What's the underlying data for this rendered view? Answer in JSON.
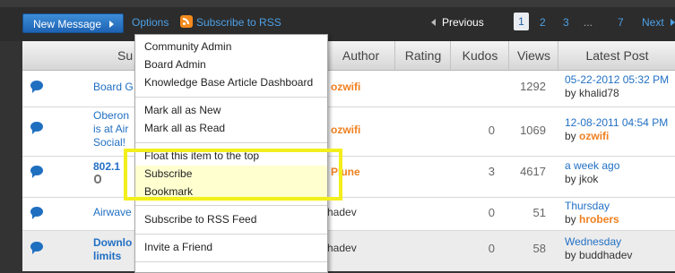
{
  "toolbar": {
    "new_message": "New Message",
    "options": "Options",
    "subscribe_rss": "Subscribe to RSS"
  },
  "pagination": {
    "previous": "Previous",
    "pages": [
      "1",
      "2",
      "3",
      "...",
      "7"
    ],
    "current": "1",
    "next": "Next"
  },
  "table": {
    "headers": [
      "Su",
      "Author",
      "Rating",
      "Kudos",
      "Views",
      "Latest Post"
    ],
    "rows": [
      {
        "subject": "Board G",
        "author": "ozwifi",
        "kudos": "",
        "views": "1292",
        "latest_date": "05-22-2012 05:32 PM",
        "latest_by_prefix": "by",
        "latest_by": "khalid78"
      },
      {
        "subject_lines": [
          "Oberon",
          "is at Air",
          "Social!"
        ],
        "author": "ozwifi",
        "kudos": "0",
        "views": "1069",
        "latest_date": "12-08-2011 04:54 PM",
        "latest_by_prefix": "by",
        "latest_by": "ozwifi"
      },
      {
        "subject": "802.1",
        "author": "Plune",
        "kudos": "3",
        "views": "4617",
        "latest_date": "a week ago",
        "latest_by_prefix": "by",
        "latest_by": "jkok"
      },
      {
        "subject": "Airwave",
        "author": "hadev",
        "kudos": "0",
        "views": "51",
        "latest_date": "Thursday",
        "latest_by_prefix": "by",
        "latest_by": "hrobers"
      },
      {
        "subject_lines": [
          "Downlo",
          "limits"
        ],
        "author": "hadev",
        "kudos": "0",
        "views": "58",
        "latest_date": "Wednesday",
        "latest_by_prefix": "by",
        "latest_by": "buddhadev"
      }
    ]
  },
  "options_menu": {
    "items": [
      "Community Admin",
      "Board Admin",
      "Knowledge Base Article Dashboard",
      "Mark all as New",
      "Mark all as Read",
      "Float this item to the top",
      "Subscribe",
      "Bookmark",
      "Subscribe to RSS Feed",
      "Invite a Friend"
    ],
    "highlighted": [
      "Subscribe",
      "Bookmark"
    ]
  },
  "colors": {
    "link": "#2270c4",
    "author_highlight": "#f08020",
    "callout": "#f2ef1c",
    "menu_highlight": "#ffffd0"
  }
}
